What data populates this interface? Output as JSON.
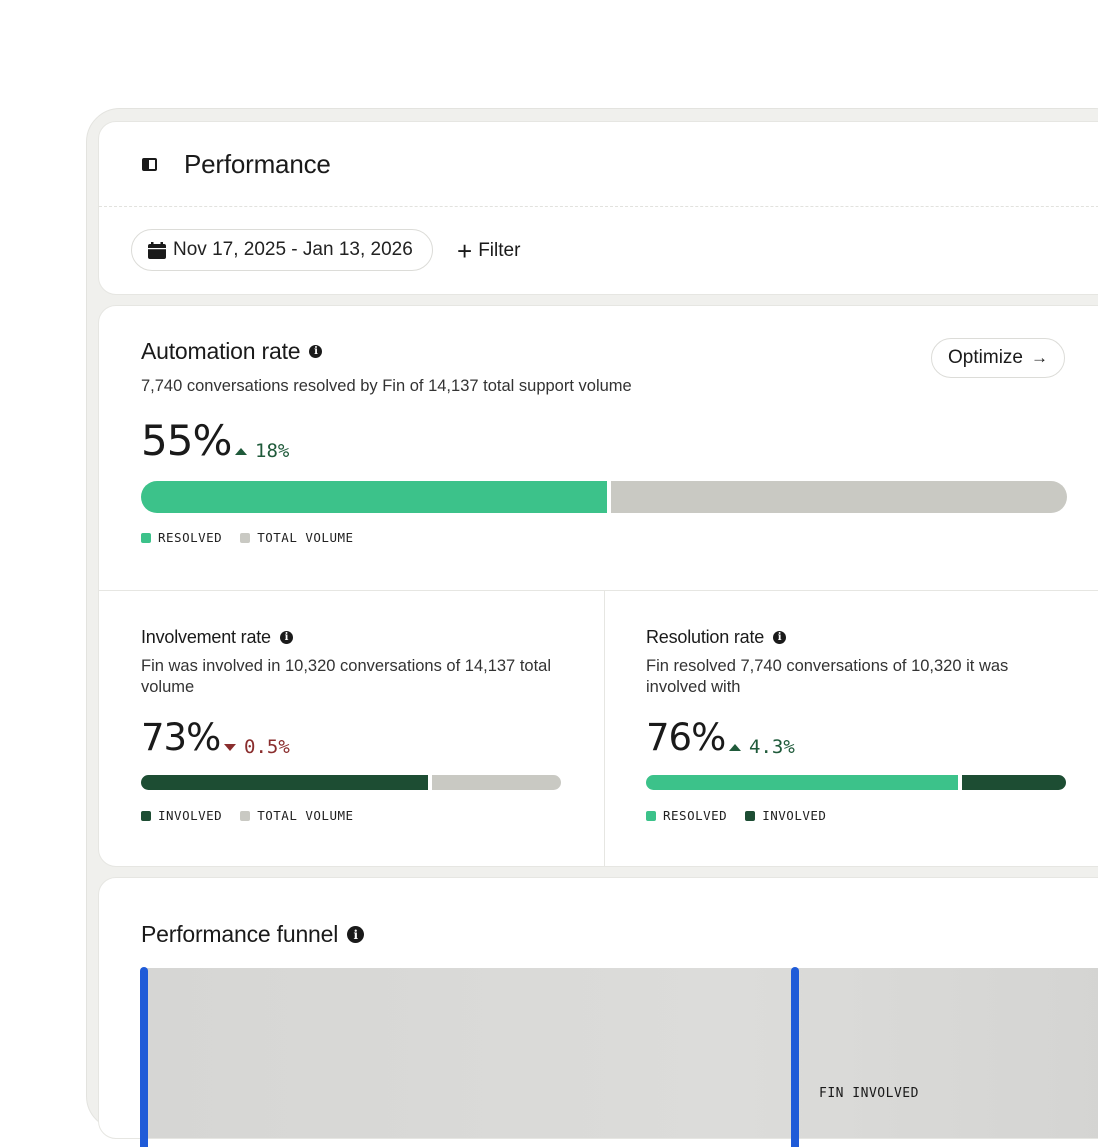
{
  "header": {
    "title": "Performance",
    "date_range": "Nov 17, 2025 - Jan 13, 2026",
    "filter_label": "Filter"
  },
  "automation": {
    "title": "Automation rate",
    "description": "7,740 conversations resolved by Fin of 14,137 total support volume",
    "value": "55%",
    "delta": "18%",
    "delta_direction": "up",
    "optimize_label": "Optimize",
    "bar": {
      "filled_fraction": 0.505
    },
    "legend": [
      "RESOLVED",
      "TOTAL VOLUME"
    ]
  },
  "involvement": {
    "title": "Involvement rate",
    "description": "Fin was involved in 10,320 conversations of 14,137 total volume",
    "value": "73%",
    "delta": "0.5%",
    "delta_direction": "down",
    "bar": {
      "filled_fraction": 0.69
    },
    "legend": [
      "INVOLVED",
      "TOTAL VOLUME"
    ]
  },
  "resolution": {
    "title": "Resolution rate",
    "description": "Fin resolved 7,740 conversations of 10,320 it was involved with",
    "value": "76%",
    "delta": "4.3%",
    "delta_direction": "up",
    "bar": {
      "filled_fraction": 0.75
    },
    "legend": [
      "RESOLVED",
      "INVOLVED"
    ]
  },
  "funnel": {
    "title": "Performance funnel",
    "stage_label": "FIN INVOLVED"
  },
  "colors": {
    "resolved": "#3cc28a",
    "total_volume": "#c9c9c3",
    "involved": "#1d4d33",
    "funnel_accent": "#1f5bd8"
  }
}
